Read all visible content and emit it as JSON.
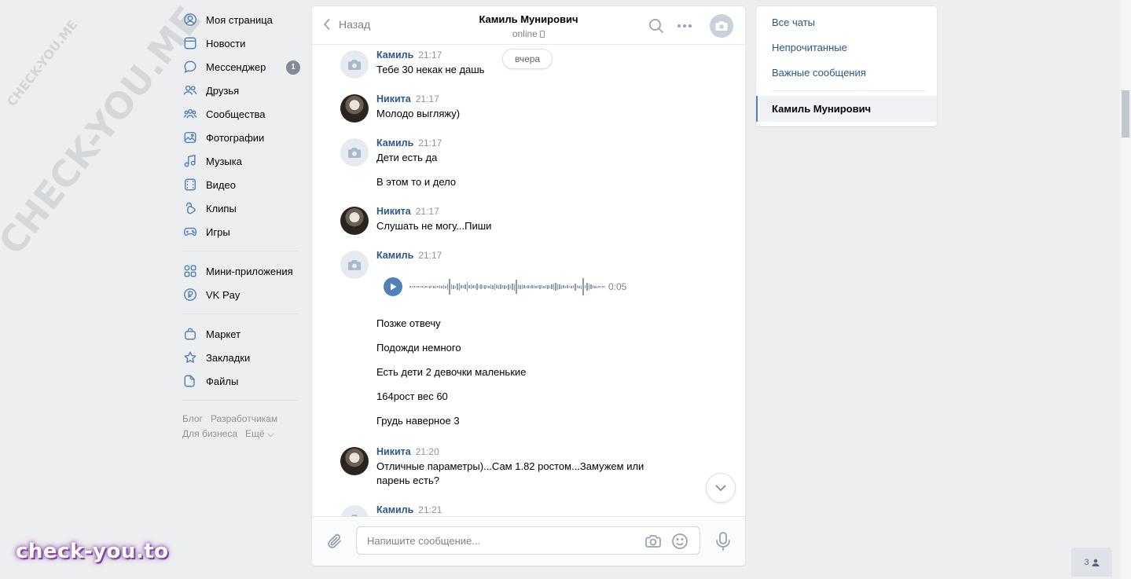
{
  "watermark": {
    "small": "CHECK-YOU.ME",
    "large": "CHECK-YOU.ME",
    "brand": "check-you.to"
  },
  "nav": {
    "items": [
      {
        "label": "Моя страница",
        "icon": "user-circle-icon"
      },
      {
        "label": "Новости",
        "icon": "news-icon"
      },
      {
        "label": "Мессенджер",
        "icon": "message-icon",
        "badge": "1"
      },
      {
        "label": "Друзья",
        "icon": "friends-icon"
      },
      {
        "label": "Сообщества",
        "icon": "groups-icon"
      },
      {
        "label": "Фотографии",
        "icon": "photo-icon"
      },
      {
        "label": "Музыка",
        "icon": "music-icon"
      },
      {
        "label": "Видео",
        "icon": "video-icon"
      },
      {
        "label": "Клипы",
        "icon": "clips-icon"
      },
      {
        "label": "Игры",
        "icon": "gamepad-icon"
      }
    ],
    "items2": [
      {
        "label": "Мини-приложения",
        "icon": "apps-icon"
      },
      {
        "label": "VK Pay",
        "icon": "vkpay-icon"
      }
    ],
    "items3": [
      {
        "label": "Маркет",
        "icon": "market-icon"
      },
      {
        "label": "Закладки",
        "icon": "star-icon"
      },
      {
        "label": "Файлы",
        "icon": "file-icon"
      }
    ],
    "footer": {
      "blog": "Блог",
      "dev": "Разработчикам",
      "biz": "Для бизнеса",
      "more": "Ещё ⌵"
    }
  },
  "chat": {
    "back_label": "Назад",
    "peer_name": "Камиль Мунирович",
    "peer_status": "online",
    "date_pill": "вчера",
    "messages": [
      {
        "author": "Камиль",
        "time": "21:17",
        "lines": [
          "Тебе 30 некак не дашь"
        ]
      },
      {
        "author": "Никита",
        "time": "21:17",
        "lines": [
          "Молодо выгляжу)"
        ]
      },
      {
        "author": "Камиль",
        "time": "21:17",
        "lines": [
          "Дети есть да",
          "В этом то и дело"
        ]
      },
      {
        "author": "Никита",
        "time": "21:17",
        "lines": [
          "Слушать не могу...Пиши"
        ]
      },
      {
        "author": "Камиль",
        "time": "21:17",
        "audio_duration": "0:05",
        "lines": [
          "Позже отвечу",
          "Подожди немного",
          "Есть дети 2 девочки маленькие",
          "164рост вес 60",
          "Грудь наверное 3"
        ]
      },
      {
        "author": "Никита",
        "time": "21:20",
        "lines": [
          "Отличные параметры)...Сам 1.82 ростом...Замужем или парень есть?"
        ]
      },
      {
        "author": "Камиль",
        "time": "21:21",
        "lines": []
      }
    ],
    "composer_placeholder": "Напишите сообщение..."
  },
  "folders": {
    "all": "Все чаты",
    "unread": "Непрочитанные",
    "important": "Важные сообщения",
    "active_chat": "Камиль Мунирович"
  },
  "chat_count": "3"
}
